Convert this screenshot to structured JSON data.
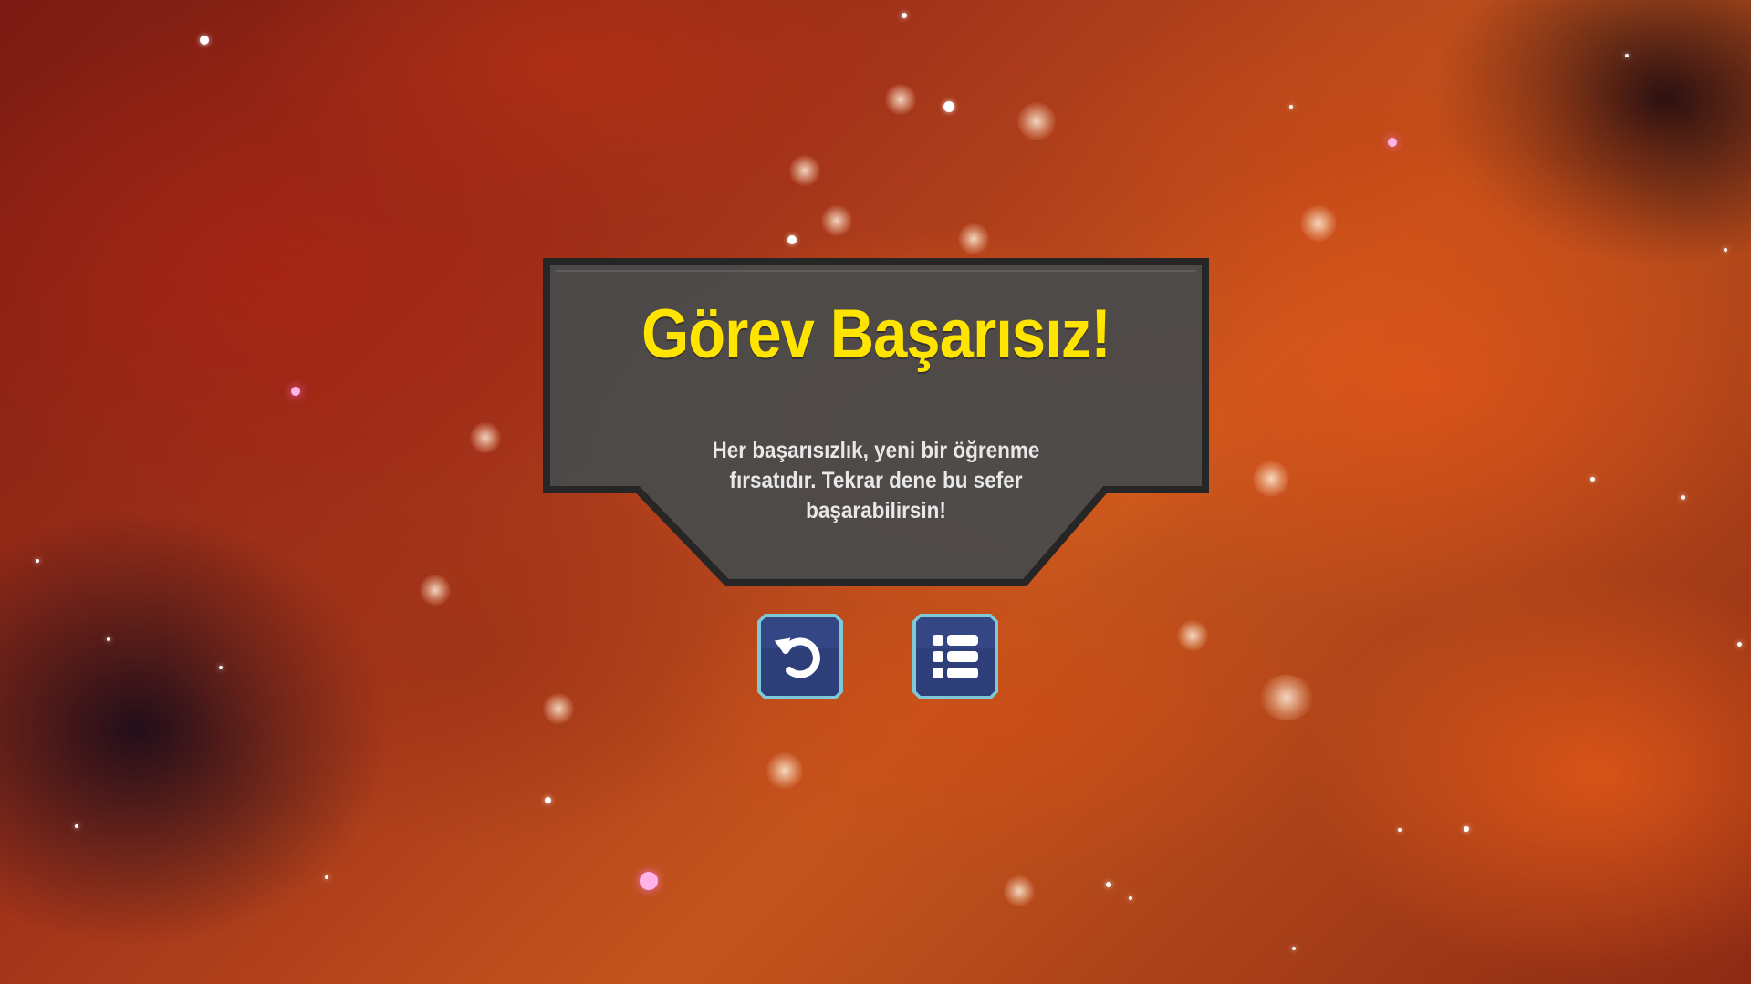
{
  "dialog": {
    "title": "Görev Başarısız!",
    "message": "Her başarısızlık, yeni bir öğrenme fırsatıdır. Tekrar dene bu sefer başarabilirsin!"
  },
  "buttons": {
    "retry_icon": "undo-arrow-icon",
    "menu_icon": "list-menu-icon"
  },
  "colors": {
    "title": "#ffe400",
    "panel": "#4a4a4a",
    "panel_border": "#2a2a2a",
    "button_fill": "#2d3e78",
    "button_border": "#7ec8d8"
  }
}
